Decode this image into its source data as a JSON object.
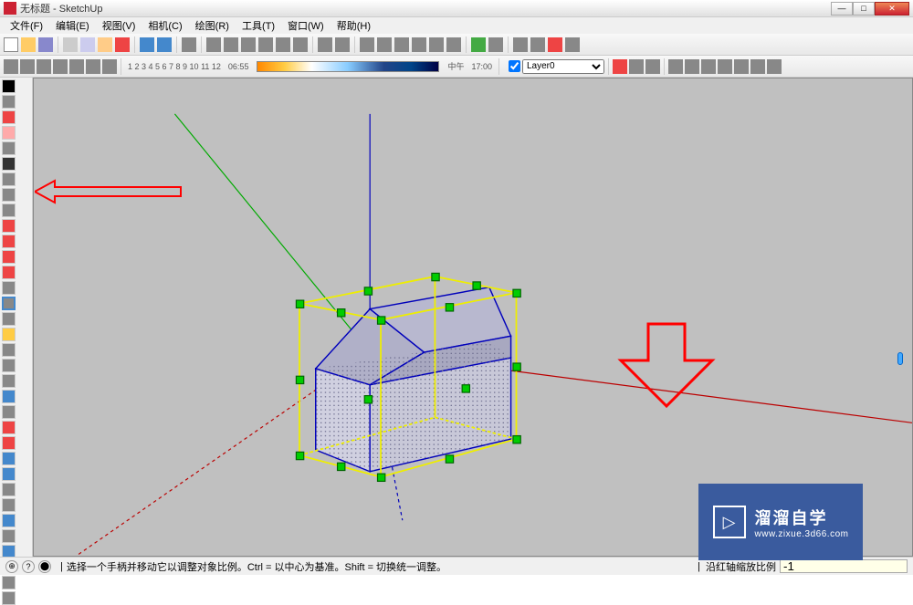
{
  "titlebar": {
    "title": "无标题 - SketchUp"
  },
  "menu": {
    "file": "文件(F)",
    "edit": "编辑(E)",
    "view": "视图(V)",
    "camera": "相机(C)",
    "draw": "绘图(R)",
    "tools": "工具(T)",
    "window": "窗口(W)",
    "help": "帮助(H)"
  },
  "toolbar2": {
    "start_time": "06:55",
    "mid_label": "中午",
    "end_time": "17:00",
    "scale_numbers": "1 2 3 4 5 6 7 8 9 10 11 12",
    "layer": "Layer0"
  },
  "status": {
    "hint": "选择一个手柄并移动它以调整对象比例。Ctrl = 以中心为基准。Shift = 切换统一调整。",
    "input_label": "沿红轴缩放比例",
    "input_value": "-1"
  },
  "watermark": {
    "cn": "溜溜自学",
    "url": "www.zixue.3d66.com"
  }
}
